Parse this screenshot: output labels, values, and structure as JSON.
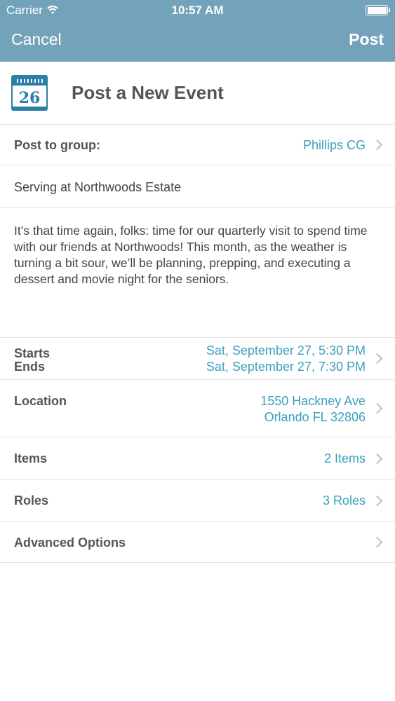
{
  "status_bar": {
    "carrier": "Carrier",
    "time": "10:57 AM",
    "battery_level": 1.0
  },
  "nav": {
    "cancel": "Cancel",
    "post": "Post"
  },
  "header": {
    "icon": "calendar-icon",
    "icon_day": "26",
    "title": "Post a New Event"
  },
  "form": {
    "group": {
      "label": "Post to group:",
      "value": "Phillips CG"
    },
    "event_title": "Serving at Northwoods Estate",
    "description": "It’s that time again, folks: time for our quarterly visit to spend time with our friends at Northwoods! This month, as the weather is turning a bit sour, we’ll be planning, prepping, and executing a dessert and movie night for the seniors.",
    "starts": {
      "label": "Starts",
      "value": "Sat, September 27, 5:30 PM"
    },
    "ends": {
      "label": "Ends",
      "value": "Sat, September 27, 7:30 PM"
    },
    "location": {
      "label": "Location",
      "line1": "1550 Hackney Ave",
      "line2": "Orlando FL 32806"
    },
    "items": {
      "label": "Items",
      "value": "2 Items"
    },
    "roles": {
      "label": "Roles",
      "value": "3 Roles"
    },
    "advanced": {
      "label": "Advanced Options"
    }
  },
  "colors": {
    "nav_bar": "#73a3ba",
    "accent": "#3aa0bd",
    "text": "#555555",
    "separator": "#e2e2e2"
  }
}
